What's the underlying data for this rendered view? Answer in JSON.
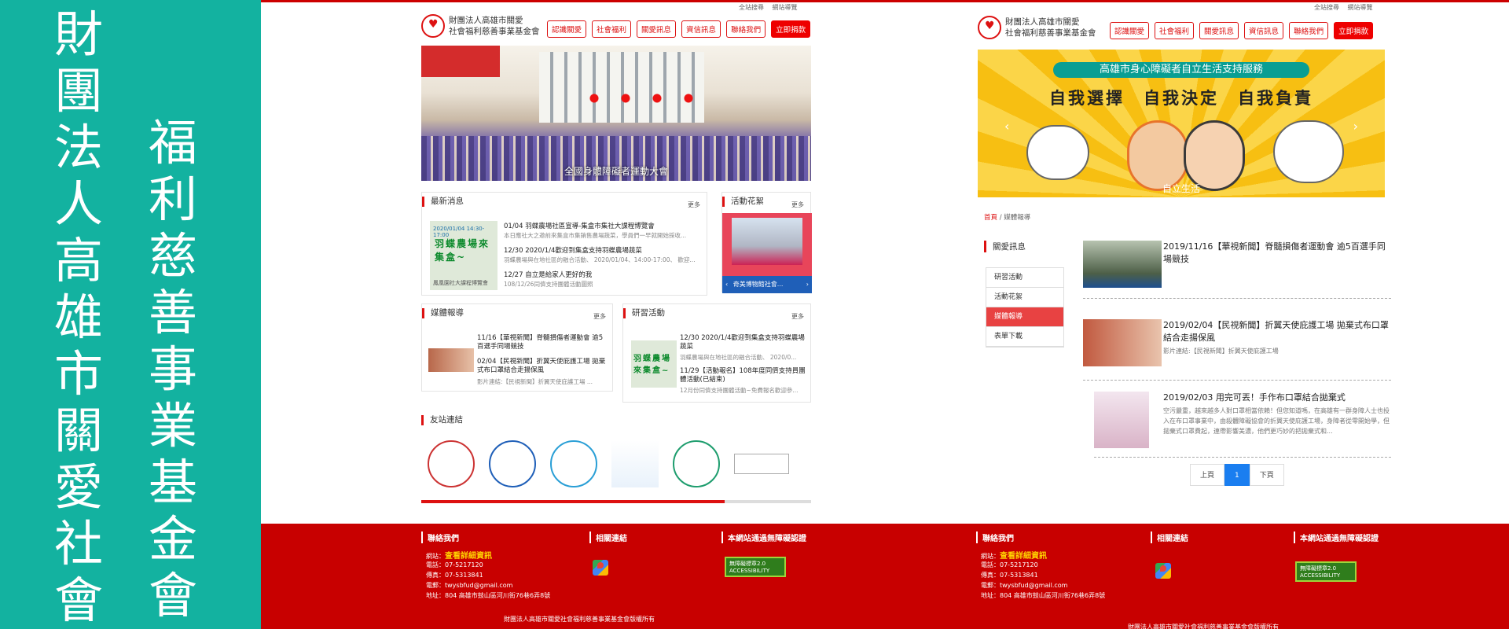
{
  "banner": {
    "col1": "財團法人高雄市關愛社會",
    "col2": "福利慈善事業基金會",
    "bg": "#13b2a0"
  },
  "site": {
    "logo_line1": "財團法人高雄市關愛",
    "logo_line2": "社會福利慈善事業基金會",
    "top_links": [
      "全站搜尋",
      "網站導覽"
    ],
    "nav": [
      "認識關愛",
      "社會福利",
      "關愛訊息",
      "資信訊息",
      "聯絡我們",
      "立即捐款"
    ],
    "accent": "#dd1111",
    "footer_color": "#c80000"
  },
  "home": {
    "hero_caption": "全國身體障礙者運動大會",
    "latest": {
      "title": "最新消息",
      "more": "更多",
      "thumb_date": "2020/01/04 14:30-17:00",
      "thumb_text": "羽蝶農場來集盒~",
      "thumb_footer": "鳳凰園社大課程博覽會",
      "items": [
        {
          "title": "01/04 羽蝶農場社區宣導-集盒市集社大課程博覽會",
          "desc": "本日應社大之邀前來集盒市集銷售農場蔬菜，學員們一早就開始採收..."
        },
        {
          "title": "12/30 2020/1/4歡迎到集盒支持羽蝶農場蔬菜",
          "desc": "羽蝶農場與在地社區的融合活動、 2020/01/04、14:00-17:00、 歡迎..."
        },
        {
          "title": "12/27 自立是給家人更好的我",
          "desc": "108/12/26同儕支持團體活動圖照"
        }
      ]
    },
    "album": {
      "title": "活動花絮",
      "more": "更多",
      "caption": "奇美博物館社會..."
    },
    "media": {
      "title": "媒體報導",
      "more": "更多",
      "items": [
        {
          "title": "11/16【華視新聞】脊髓損傷者運動會 逾5百選手同場競技",
          "desc": ""
        },
        {
          "title": "02/04【民視新聞】折翼天使庇護工場 拋棄式布口罩結合走揚保風",
          "desc": "影片連結:【民視新聞】折翼天使庇護工場 ..."
        }
      ]
    },
    "training": {
      "title": "研習活動",
      "more": "更多",
      "items": [
        {
          "title": "12/30 2020/1/4歡迎到集盒支持羽蝶農場蔬菜",
          "desc": "羽蝶農場與在地社區的融合活動、 2020/0..."
        },
        {
          "title": "11/29【活動報名】108年度同儕支持員團體活動(已結束)",
          "desc": "12月份同儕支持團體活動~免費報名歡迎參..."
        }
      ]
    },
    "friends": {
      "title": "友站連結"
    }
  },
  "media_page": {
    "hero_ribbon": "高雄市身心障礙者自立生活支持服務",
    "hero_slogan": "自我選擇　自我決定　自我負責",
    "hero_caption": "自立生活",
    "breadcrumb_home": "首頁",
    "breadcrumb_current": "媒體報導",
    "sidebar_title": "關愛訊息",
    "sidebar_items": [
      "研習活動",
      "活動花絮",
      "媒體報導",
      "表單下載"
    ],
    "sidebar_active": 2,
    "articles": [
      {
        "title": "2019/11/16【華視新聞】脊髓損傷者運動會 逾5百選手同場競技",
        "desc": ""
      },
      {
        "title": "2019/02/04【民視新聞】折翼天使庇護工場 拋棄式布口罩結合走揚保風",
        "desc": "影片連結:【民視新聞】折翼天使庇護工場"
      },
      {
        "title": "2019/02/03 用完可丟！手作布口罩結合拋棄式",
        "desc": "空污嚴重，越來越多人對口罩相當依賴！但您知道嗎，在高雄有一群身障人士也投入在布口罩事業中，由殺體障礙協會的折翼天使庇護工場，身障者從零開始學，但拋棄式口罩費起，連帶影響美濃，他們更巧妙的把拋棄式和..."
      }
    ],
    "pager": [
      "上頁",
      "1",
      "下頁"
    ]
  },
  "footer": {
    "contact_title": "聯絡我們",
    "links_title": "相關連結",
    "accessibility_title": "本網站通過無障礙認證",
    "details_prefix": "網站：",
    "details_link": "查看詳細資訊",
    "phone": "電話：07-5217120",
    "fax": "傳真：07-5313841",
    "email": "電郵：twysbfud@gmail.com",
    "address": "地址：804 高雄市鼓山區河川街76巷6弄8號",
    "acc_badge": "無障礙標章2.0",
    "acc_sub": "ACCESSIBILITY",
    "copyright": "財團法人高雄市關愛社會福利慈善事業基金會版權所有"
  }
}
